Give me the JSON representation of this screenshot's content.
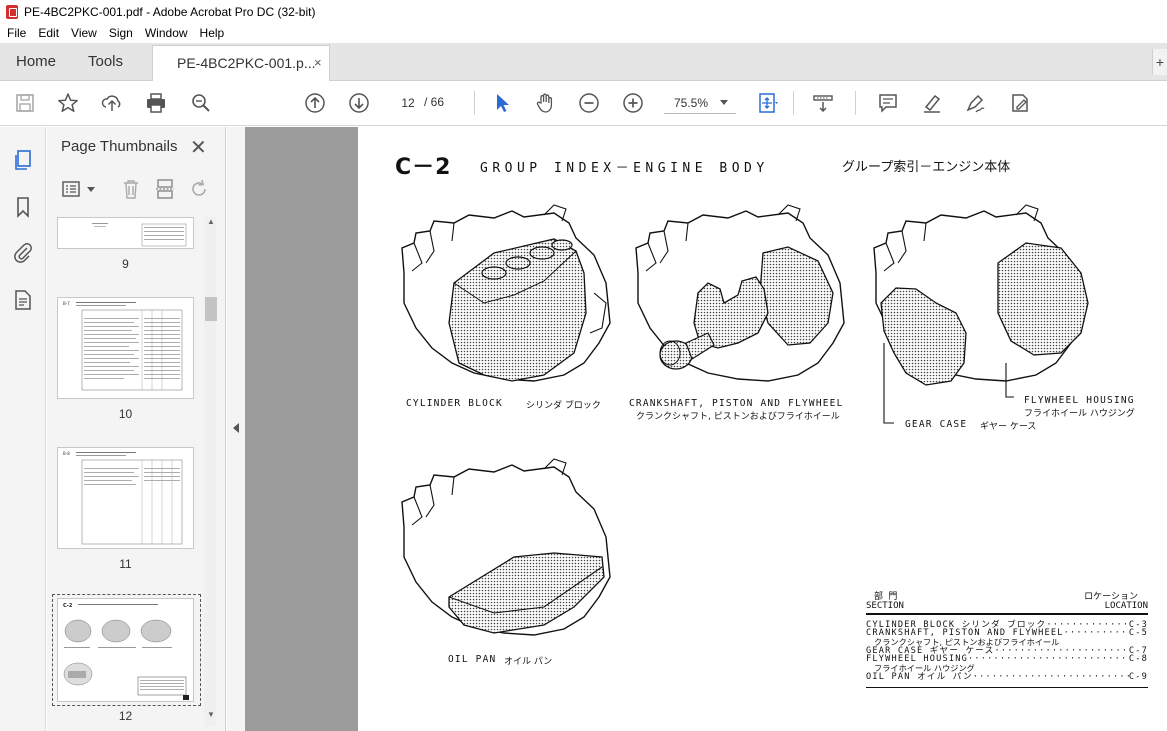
{
  "window": {
    "title": "PE-4BC2PKC-001.pdf - Adobe Acrobat Pro DC (32-bit)"
  },
  "menu": [
    "File",
    "Edit",
    "View",
    "Sign",
    "Window",
    "Help"
  ],
  "tabs": {
    "home": "Home",
    "tools": "Tools",
    "document": "PE-4BC2PKC-001.p...",
    "close": "×",
    "add": "+"
  },
  "toolbar": {
    "current_page": "12",
    "page_total": "/   66",
    "zoom": "75.5%",
    "icons": [
      "save-icon",
      "star-icon",
      "upload-icon",
      "print-icon",
      "search-icon",
      "page-up-icon",
      "page-down-icon",
      "select-arrow-icon",
      "hand-icon",
      "zoom-out-icon",
      "zoom-in-icon",
      "fit-page-icon",
      "scroll-mode-icon",
      "comment-icon",
      "highlight-icon",
      "sign-icon",
      "edit-pdf-icon"
    ]
  },
  "rail": {
    "icons": [
      "pages-icon",
      "bookmark-icon",
      "attachment-icon",
      "document-properties-icon"
    ]
  },
  "panel": {
    "title": "Page Thumbnails",
    "close": "✕",
    "thumbnails": [
      {
        "label": "9"
      },
      {
        "label": "10"
      },
      {
        "label": "11"
      },
      {
        "label": "12"
      }
    ]
  },
  "document": {
    "code": "C－2",
    "heading": "GROUP INDEX－ENGINE BODY",
    "heading_jp": "グループ索引－エンジン本体",
    "captions": {
      "cylinder_block": "CYLINDER BLOCK",
      "cylinder_block_jp": "シリンダ ブロック",
      "crankshaft": "CRANKSHAFT, PISTON AND FLYWHEEL",
      "crankshaft_jp": "クランクシャフト, ピストンおよびフライホイール",
      "flywheel_housing": "FLYWHEEL HOUSING",
      "flywheel_housing_jp": "フライホイール ハウジング",
      "gear_case": "GEAR CASE",
      "gear_case_jp": "ギヤー ケース",
      "oil_pan": "OIL PAN",
      "oil_pan_jp": "オイル パン"
    },
    "index": {
      "section_jp": "部 門",
      "section": "SECTION",
      "location_jp": "ロケーション",
      "location": "LOCATION",
      "rows": [
        {
          "section": "CYLINDER BLOCK シリンダ ブロック",
          "location": "C-3"
        },
        {
          "section": "CRANKSHAFT, PISTON AND FLYWHEEL",
          "location": "C-5",
          "sub": "クランクシャフト, ピストンおよびフライホイール"
        },
        {
          "section": "GEAR CASE ギヤー ケース",
          "location": "C-7"
        },
        {
          "section": "FLYWHEEL HOUSING",
          "location": "C-8",
          "sub": "フライホイール ハウジング"
        },
        {
          "section": "OIL PAN オイル パン",
          "location": "C-9"
        }
      ]
    }
  }
}
